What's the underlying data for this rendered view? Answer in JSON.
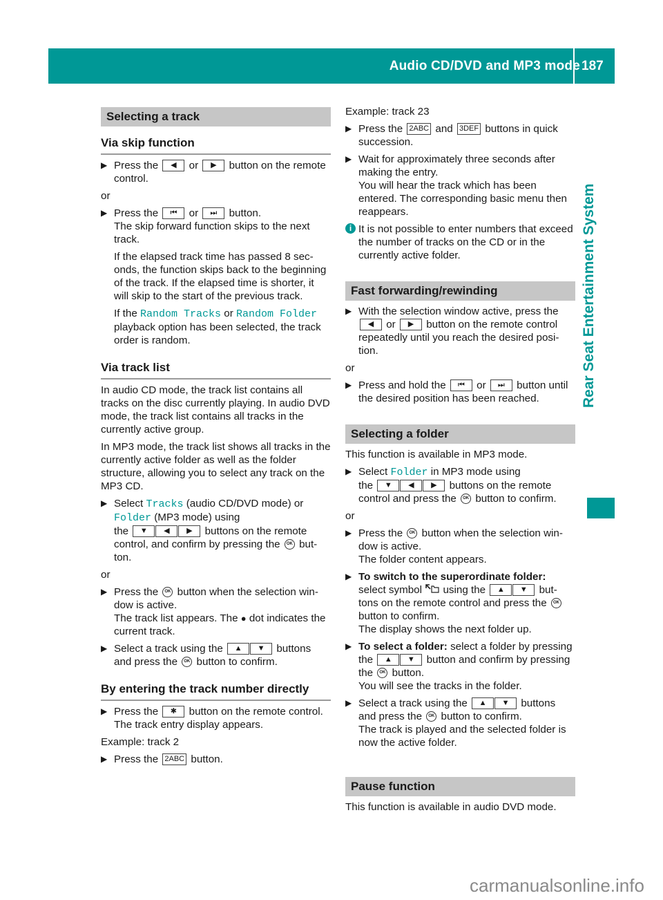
{
  "header": {
    "title": "Audio CD/DVD and MP3 mode",
    "page_number": "187",
    "side_label": "Rear Seat Entertainment System",
    "accent_color": "#009896"
  },
  "icons": {
    "left": "◀",
    "right": "▶",
    "up": "▲",
    "down": "▼",
    "skip_back": "⏮",
    "skip_fwd": "⏭",
    "star": "✱",
    "key_2": "2ABC",
    "key_3": "3DEF",
    "ok": "OK",
    "bullet_arrow": "▶",
    "folder_up": "⮤🗀",
    "info": "i",
    "dot": "●"
  },
  "col1": {
    "section_title": "Selecting a track",
    "skip": {
      "title": "Via skip function",
      "step1_a": "Press the",
      "step1_or": "or",
      "step1_b": "button on the remote control.",
      "or1": "or",
      "step2_a": "Press the",
      "step2_or": "or",
      "step2_b": "button.",
      "step2_c": "The skip forward function skips to the next track.",
      "step2_d": "If the elapsed track time has passed 8 sec-onds, the function skips back to the beginning of the track. If the elapsed time is shorter, it will skip to the start of the previous track.",
      "step2_e1": "If the",
      "random_tracks": "Random Tracks",
      "step2_e2": "or",
      "random_folder": "Random Folder",
      "step2_e3": "playback option has been selected, the track order is random."
    },
    "list": {
      "title": "Via track list",
      "p1": "In audio CD mode, the track list contains all tracks on the disc currently playing. In audio DVD mode, the track list contains all tracks in the currently active group.",
      "p2": "In MP3 mode, the track list shows all tracks in the currently active folder as well as the folder structure, allowing you to select any track on the MP3 CD.",
      "s1_a": "Select",
      "tracks": "Tracks",
      "s1_b": "(audio CD/DVD mode) or",
      "folder": "Folder",
      "s1_c": "(MP3 mode) using",
      "s1_d": "the",
      "s1_e": "buttons on the remote control, and confirm by pressing the",
      "s1_f": "but-ton.",
      "or1": "or",
      "s2_a": "Press the",
      "s2_b": "button when the selection win-dow is active.",
      "s2_c": "The track list appears. The",
      "s2_d": "dot indicates the current track.",
      "s3_a": "Select a track using the",
      "s3_b": "buttons and press the",
      "s3_c": "button to confirm."
    },
    "direct": {
      "title": "By entering the track number directly",
      "s1_a": "Press the",
      "s1_b": "button on the remote control.",
      "s1_c": "The track entry display appears.",
      "example": "Example: track 2",
      "s2_a": "Press the",
      "s2_b": "button."
    }
  },
  "col2": {
    "example": "Example: track 23",
    "s1_a": "Press the",
    "s1_and": "and",
    "s1_b": "buttons in quick succession.",
    "s2_a": "Wait for approximately three seconds after making the entry.",
    "s2_b": "You will hear the track which has been entered. The corresponding basic menu then reappears.",
    "note": "It is not possible to enter numbers that exceed the number of tracks on the CD or in the currently active folder.",
    "ff": {
      "title": "Fast forwarding/rewinding",
      "s1_a": "With the selection window active, press the",
      "s1_or": "or",
      "s1_b": "button on the remote control repeatedly until you reach the desired posi-tion.",
      "or1": "or",
      "s2_a": "Press and hold the",
      "s2_or": "or",
      "s2_b": "button until the desired position has been reached."
    },
    "folder": {
      "title": "Selecting a folder",
      "intro": "This function is available in MP3 mode.",
      "s1_a": "Select",
      "folder": "Folder",
      "s1_b": "in MP3 mode using",
      "s1_c": "the",
      "s1_d": "buttons on the remote control and press the",
      "s1_e": "button to confirm.",
      "or1": "or",
      "s2_a": "Press the",
      "s2_b": "button when the selection win-dow is active.",
      "s2_c": "The folder content appears.",
      "s3_bold": "To switch to the superordinate folder:",
      "s3_a": "select symbol",
      "s3_b": "using the",
      "s3_c": "but-tons on the remote control and press the",
      "s3_d": "button to confirm.",
      "s3_e": "The display shows the next folder up.",
      "s4_bold": "To select a folder:",
      "s4_a": "select a folder by pressing the",
      "s4_b": "button and confirm by pressing the",
      "s4_c": "button.",
      "s4_d": "You will see the tracks in the folder.",
      "s5_a": "Select a track using the",
      "s5_b": "buttons and press the",
      "s5_c": "button to confirm.",
      "s5_d": "The track is played and the selected folder is now the active folder."
    },
    "pause": {
      "title": "Pause function",
      "intro": "This function is available in audio DVD mode."
    }
  },
  "watermark": "carmanualsonline.info"
}
